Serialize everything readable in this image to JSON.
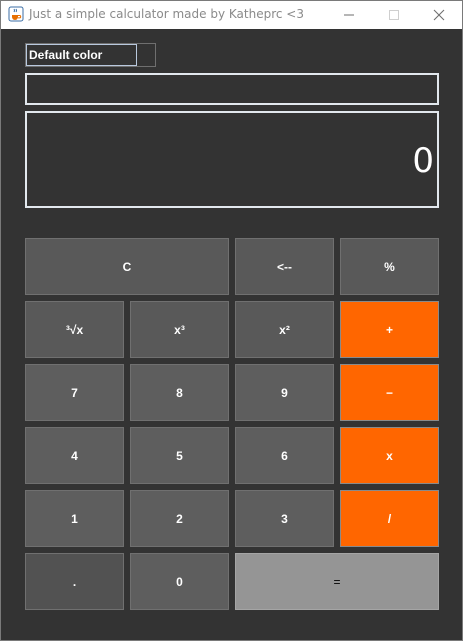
{
  "window": {
    "title": "Just a simple calculator made by Katheprc <3",
    "minimize_icon": "minimize-icon",
    "maximize_icon": "maximize-icon",
    "close_icon": "close-icon",
    "app_icon": "java-cup-icon"
  },
  "color_selector": {
    "selected": "Default color",
    "arrow_icon": "dropdown-arrow-icon"
  },
  "expression_field": {
    "value": ""
  },
  "display": {
    "value": "0"
  },
  "keys": {
    "clear": "C",
    "backspace": "<--",
    "percent": "%",
    "cube_root": "³√x",
    "cube": "x³",
    "square": "x²",
    "plus": "+",
    "seven": "7",
    "eight": "8",
    "nine": "9",
    "minus": "−",
    "four": "4",
    "five": "5",
    "six": "6",
    "multiply": "x",
    "one": "1",
    "two": "2",
    "three": "3",
    "divide": "/",
    "dot": ".",
    "zero": "0",
    "equals": "="
  },
  "colors": {
    "background": "#333333",
    "operator_key": "#ff6600",
    "number_key": "#5e5e5e",
    "equals_key": "#959595",
    "field_border": "#e2e8ee"
  }
}
